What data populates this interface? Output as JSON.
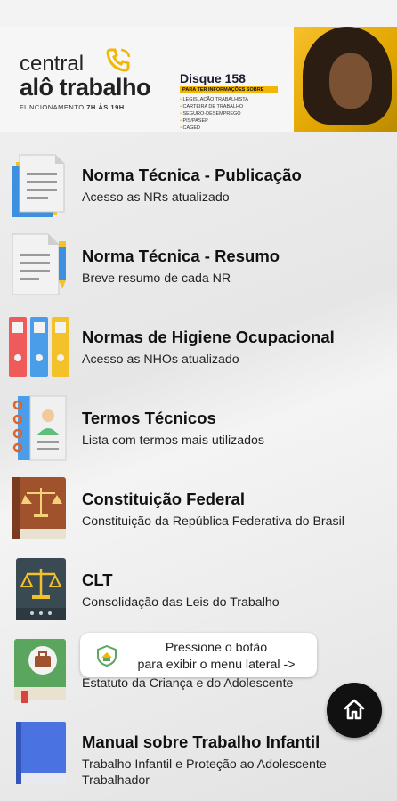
{
  "banner": {
    "brand_line1": "central",
    "brand_line2": "alô trabalho",
    "hours_label": "FUNCIONAMENTO",
    "hours_value": "7H ÀS 19H",
    "disque_title": "Disque 158",
    "disque_subtitle": "PARA TER INFORMAÇÕES SOBRE",
    "topics": [
      "LEGISLAÇÃO TRABALHISTA",
      "CARTEIRA DE TRABALHO",
      "SEGURO-DESEMPREGO",
      "PIS/PASEP",
      "CAGED"
    ]
  },
  "items": [
    {
      "title": "Norma Técnica - Publicação",
      "subtitle": "Acesso as NRs atualizado",
      "icon": "documents-icon"
    },
    {
      "title": "Norma Técnica - Resumo",
      "subtitle": "Breve resumo de cada NR",
      "icon": "document-pen-icon"
    },
    {
      "title": "Normas de Higiene Ocupacional",
      "subtitle": "Acesso as NHOs atualizado",
      "icon": "binders-icon"
    },
    {
      "title": "Termos Técnicos",
      "subtitle": "Lista com termos mais utilizados",
      "icon": "notebook-icon"
    },
    {
      "title": "Constituição Federal",
      "subtitle": "Constituição da República Federativa do Brasil",
      "icon": "law-book-icon"
    },
    {
      "title": "CLT",
      "subtitle": "Consolidação das Leis do Trabalho",
      "icon": "scales-book-icon"
    },
    {
      "title": "",
      "subtitle": "Estatuto da Criança e do Adolescente",
      "icon": "briefcase-book-icon"
    },
    {
      "title": "Manual sobre Trabalho Infantil",
      "subtitle": "Trabalho Infantil e Proteção ao Adolescente Trabalhador",
      "icon": "blue-book-icon"
    }
  ],
  "toast": {
    "line1": "Pressione o botão",
    "line2": "para exibir o menu lateral ->"
  },
  "colors": {
    "accent_yellow": "#f2b705",
    "fab": "#111111"
  }
}
